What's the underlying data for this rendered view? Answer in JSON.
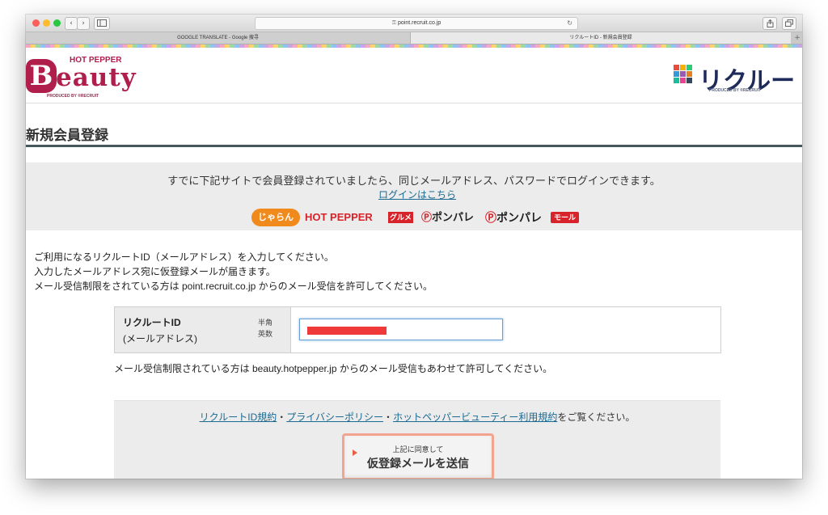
{
  "browser": {
    "url": "point.recruit.co.jp",
    "tabs": [
      {
        "label": "GOOGLE TRANSLATE - Google 搜寻"
      },
      {
        "label": "リクルートID - 新規会員登録"
      }
    ],
    "buttons": {
      "back": "‹",
      "forward": "›",
      "new_tab": "+"
    },
    "colors": {
      "close": "#fc5f57",
      "minimize": "#fdbc2e",
      "zoom": "#28c840"
    }
  },
  "header": {
    "beauty_logo": {
      "top_label": "HOT PEPPER",
      "letter": "B",
      "word": "eauty",
      "produced_by": "PRODUCED BY ®RECRUIT",
      "color": "#b01e4c"
    },
    "recruit_id_logo": {
      "text": "リクルートID",
      "produced_by": "PRODUCED BY ®RECRUIT",
      "grid_colors": [
        "#e74c3c",
        "#f5b000",
        "#2ecc71",
        "#3498db",
        "#9b59b6",
        "#e67e22",
        "#1abc9c",
        "#e84393",
        "#34495e"
      ]
    }
  },
  "main": {
    "page_title": "新規会員登録",
    "notice": {
      "text": "すでに下記サイトで会員登録されていましたら、同じメールアドレス、パスワードでログインできます。",
      "login_link": "ログインはこちら",
      "partner_logos": [
        "じゃらん",
        "HOT PEPPER",
        "グルメ",
        "ポンパレ",
        "ポンパレ",
        "モール"
      ]
    },
    "intro": [
      "ご利用になるリクルートID（メールアドレス）を入力してください。",
      "入力したメールアドレス宛に仮登録メールが届きます。",
      "メール受信制限をされている方は point.recruit.co.jp からのメール受信を許可してください。"
    ],
    "form": {
      "label_main": "リクルートID",
      "label_sub": "(メールアドレス)",
      "half_width_1": "半角",
      "half_width_2": "英数",
      "email_value": ""
    },
    "note": "メール受信制限されている方は beauty.hotpepper.jp からのメール受信もあわせて許可してください。",
    "terms": {
      "link1": "リクルートID規約",
      "sep1": "・",
      "link2": "プライバシーポリシー",
      "sep2": "・",
      "link3": "ホットペッパービューティー利用規約",
      "suffix": "をご覧ください。"
    },
    "submit": {
      "small": "上記に同意して",
      "main": "仮登録メールを送信"
    }
  }
}
